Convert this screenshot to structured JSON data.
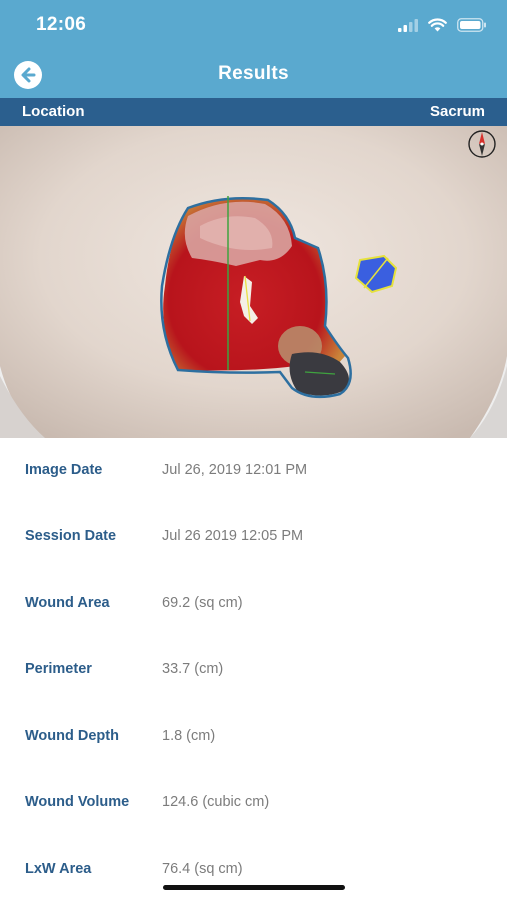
{
  "status_bar": {
    "time": "12:06",
    "icons": [
      "cellular-signal-icon",
      "wifi-icon",
      "battery-icon"
    ]
  },
  "navbar": {
    "title": "Results",
    "back_icon": "back-arrow-icon"
  },
  "location_bar": {
    "label": "Location",
    "value": "Sacrum"
  },
  "image": {
    "compass_icon": "compass-icon"
  },
  "details": [
    {
      "label": "Image Date",
      "value": "Jul 26, 2019 12:01 PM"
    },
    {
      "label": "Session Date",
      "value": "Jul 26 2019 12:05 PM"
    },
    {
      "label": "Wound Area",
      "value": "69.2 (sq cm)"
    },
    {
      "label": "Perimeter",
      "value": "33.7 (cm)"
    },
    {
      "label": "Wound Depth",
      "value": "1.8 (cm)"
    },
    {
      "label": "Wound Volume",
      "value": "124.6 (cubic cm)"
    },
    {
      "label": "LxW Area",
      "value": "76.4 (sq cm)"
    }
  ],
  "colors": {
    "header": "#5aa9cf",
    "location_bar": "#2b5f8e",
    "label": "#2c5d8a",
    "value": "#7c7c7c"
  }
}
